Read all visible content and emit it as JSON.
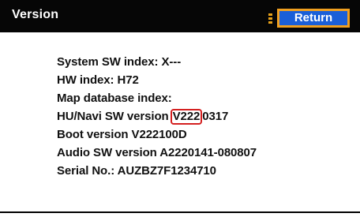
{
  "header": {
    "title": "Version",
    "return_label": "Return"
  },
  "info_lines": [
    {
      "text": "System SW index: X---"
    },
    {
      "text": "HW index: H72"
    },
    {
      "text": "Map database index:"
    },
    {
      "prefix": "HU/Navi SW version ",
      "highlight": "V222",
      "suffix": "0317"
    },
    {
      "text": "Boot version V222100D"
    },
    {
      "text": "Audio SW version A2220141-080807"
    },
    {
      "text": "Serial No.: AUZBZ7F1234710"
    }
  ],
  "colors": {
    "header_bg": "#060606",
    "button_bg": "#1a5fd8",
    "button_border": "#f0a020",
    "indicator": "#e8a21a",
    "highlight_box": "#d42020"
  }
}
